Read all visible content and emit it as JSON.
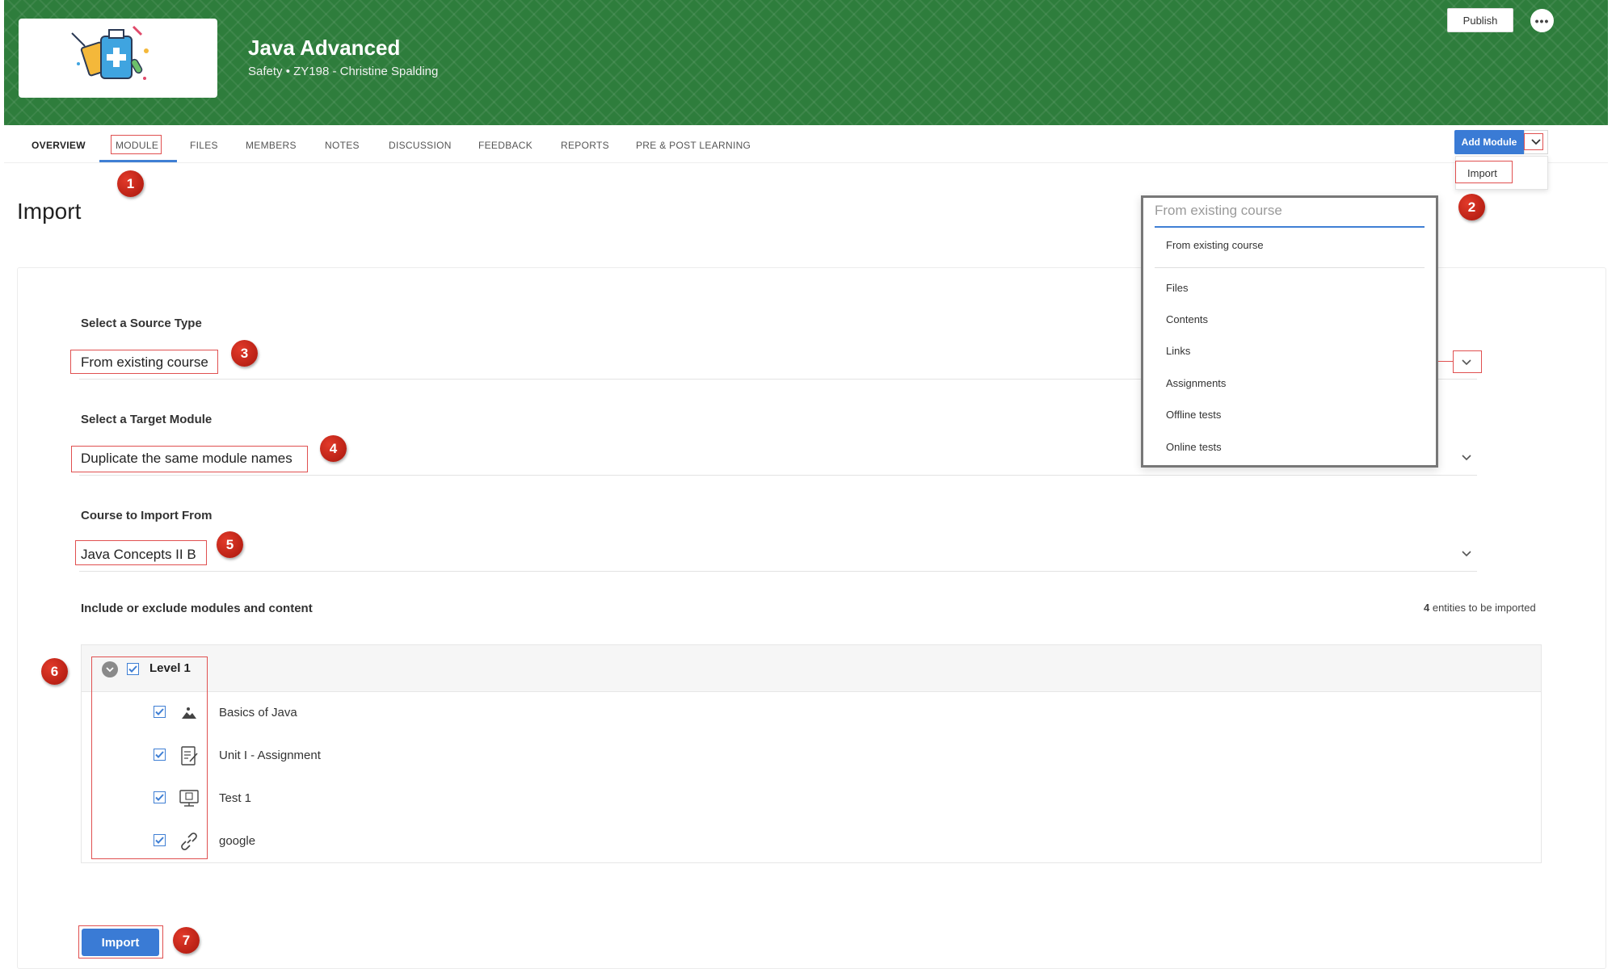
{
  "course": {
    "title": "Java Advanced",
    "subtitle": "Safety  •  ZY198 - Christine Spalding",
    "publish_label": "Publish",
    "more_label": "•••"
  },
  "tabs": [
    {
      "label": "OVERVIEW"
    },
    {
      "label": "MODULE"
    },
    {
      "label": "FILES"
    },
    {
      "label": "MEMBERS"
    },
    {
      "label": "NOTES"
    },
    {
      "label": "DISCUSSION"
    },
    {
      "label": "FEEDBACK"
    },
    {
      "label": "REPORTS"
    },
    {
      "label": "PRE & POST LEARNING"
    }
  ],
  "add_module": {
    "button_label": "Add Module",
    "menu_item": "Import"
  },
  "page": {
    "title": "Import"
  },
  "form": {
    "source_type": {
      "label": "Select a Source Type",
      "value": "From existing course"
    },
    "target_module": {
      "label": "Select a Target Module",
      "value": "Duplicate the same module names"
    },
    "course_from": {
      "label": "Course to Import From",
      "value": "Java Concepts II B"
    },
    "include_label": "Include or exclude modules and content",
    "entities_count": "4",
    "entities_suffix": " entities to be imported"
  },
  "dropdown": {
    "header": "From existing course",
    "options": [
      "From existing course",
      "Files",
      "Contents",
      "Links",
      "Assignments",
      "Offline tests",
      "Online tests"
    ]
  },
  "tree": {
    "level_label": "Level 1",
    "items": [
      {
        "label": "Basics of Java",
        "icon": "image-icon"
      },
      {
        "label": "Unit I - Assignment",
        "icon": "assignment-icon"
      },
      {
        "label": "Test 1",
        "icon": "online-test-icon"
      },
      {
        "label": "google",
        "icon": "link-icon"
      }
    ]
  },
  "import_button_label": "Import",
  "markers": [
    "1",
    "2",
    "3",
    "4",
    "5",
    "6",
    "7"
  ],
  "colors": {
    "banner": "#2e7d3c",
    "accent": "#3a7bd5",
    "annotation": "#e05050",
    "marker": "#c4231a"
  }
}
